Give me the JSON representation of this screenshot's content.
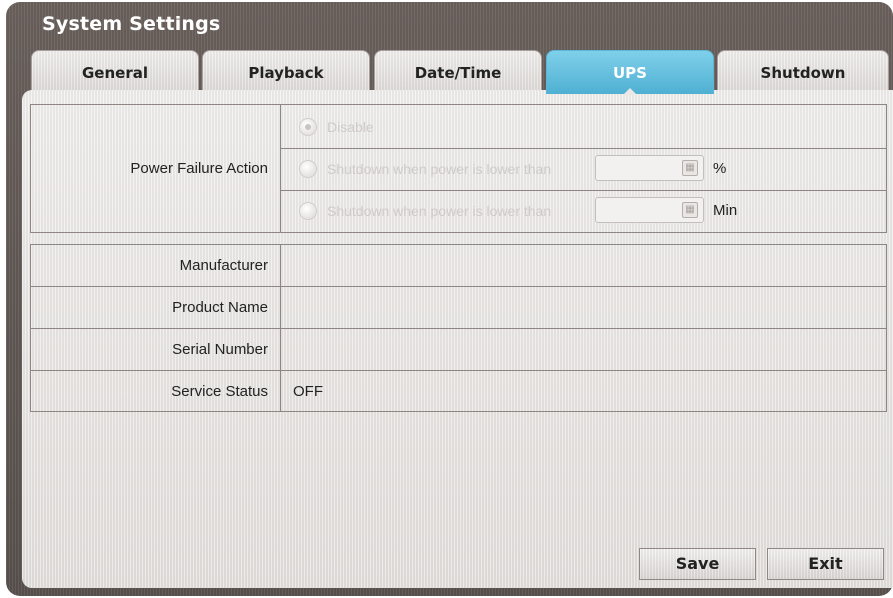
{
  "window": {
    "title": "System Settings"
  },
  "tabs": [
    {
      "label": "General",
      "active": false
    },
    {
      "label": "Playback",
      "active": false
    },
    {
      "label": "Date/Time",
      "active": false
    },
    {
      "label": "UPS",
      "active": true
    },
    {
      "label": "Shutdown",
      "active": false
    }
  ],
  "power_failure": {
    "label": "Power Failure Action",
    "options": [
      {
        "label": "Disable",
        "selected": true,
        "enabled": false
      },
      {
        "label": "Shutdown when power is lower than",
        "selected": false,
        "enabled": false,
        "value": "",
        "unit": "%"
      },
      {
        "label": "Shutdown when power is lower than",
        "selected": false,
        "enabled": false,
        "value": "",
        "unit": "Min"
      }
    ]
  },
  "info": [
    {
      "label": "Manufacturer",
      "value": ""
    },
    {
      "label": "Product Name",
      "value": ""
    },
    {
      "label": "Serial Number",
      "value": ""
    },
    {
      "label": "Service Status",
      "value": "OFF"
    }
  ],
  "buttons": {
    "save": "Save",
    "exit": "Exit"
  },
  "icons": {
    "keyboard": "keyboard-icon"
  },
  "colors": {
    "active_tab": "#4fb0d2",
    "frame": "#5f5754"
  }
}
